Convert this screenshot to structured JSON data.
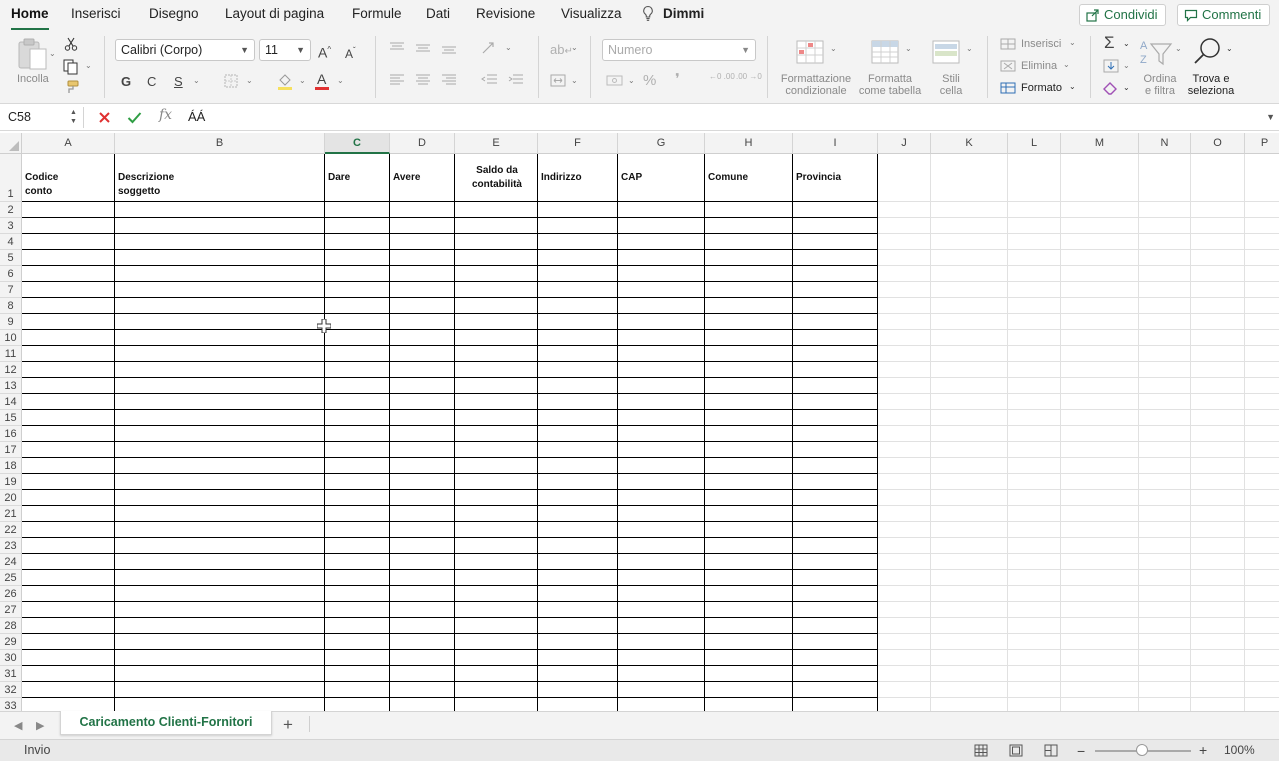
{
  "tabs": [
    {
      "label": "Home",
      "active": true
    },
    {
      "label": "Inserisci"
    },
    {
      "label": "Disegno"
    },
    {
      "label": "Layout di pagina"
    },
    {
      "label": "Formule"
    },
    {
      "label": "Dati"
    },
    {
      "label": "Revisione"
    },
    {
      "label": "Visualizza"
    },
    {
      "label": "Dimmi"
    }
  ],
  "share": {
    "share_label": "Condividi",
    "comments_label": "Commenti"
  },
  "ribbon": {
    "paste_label": "Incolla",
    "font_name": "Calibri (Corpo)",
    "font_size": "11",
    "bold_label": "G",
    "italic_label": "C",
    "underline_label": "S",
    "number_format": "Numero",
    "percent_label": "%",
    "comma_label": "❜",
    "dec_inc_label": "←0 .00",
    "dec_dec_label": ".00 →0",
    "conditional_format_label_1": "Formattazione",
    "conditional_format_label_2": "condizionale",
    "format_table_label_1": "Formatta",
    "format_table_label_2": "come tabella",
    "cell_styles_label_1": "Stili",
    "cell_styles_label_2": "cella",
    "insert_label": "Inserisci",
    "delete_label": "Elimina",
    "format_label": "Formato",
    "sort_filter_label_1": "Ordina",
    "sort_filter_label_2": "e filtra",
    "find_select_label_1": "Trova e",
    "find_select_label_2": "seleziona",
    "accent_color": "#217346"
  },
  "formula_bar": {
    "name_box": "C58",
    "fx_label": "fx",
    "content": "ÁÁ"
  },
  "grid": {
    "columns": [
      "A",
      "B",
      "C",
      "D",
      "E",
      "F",
      "G",
      "H",
      "I",
      "J",
      "K",
      "L",
      "M",
      "N",
      "O",
      "P"
    ],
    "selected_column": "C",
    "rows": [
      "1",
      "2",
      "3",
      "4",
      "5",
      "6",
      "7",
      "8",
      "9",
      "10",
      "11",
      "12",
      "13",
      "14",
      "15",
      "16",
      "17",
      "18",
      "19",
      "20",
      "21",
      "22",
      "23",
      "24",
      "25",
      "26",
      "27",
      "28",
      "29",
      "30",
      "31",
      "32",
      "33"
    ],
    "header_cells": {
      "A": "Codice conto",
      "B": "Descrizione soggetto",
      "C": "Dare",
      "D": "Avere",
      "E_1": "Saldo da",
      "E_2": "contabilità",
      "F": "Indirizzo",
      "G": "CAP",
      "H": "Comune",
      "I": "Provincia"
    }
  },
  "sheets": {
    "active": "Caricamento Clienti-Fornitori",
    "add_label": "+"
  },
  "status": {
    "text": "Invio",
    "zoom": "100%"
  }
}
